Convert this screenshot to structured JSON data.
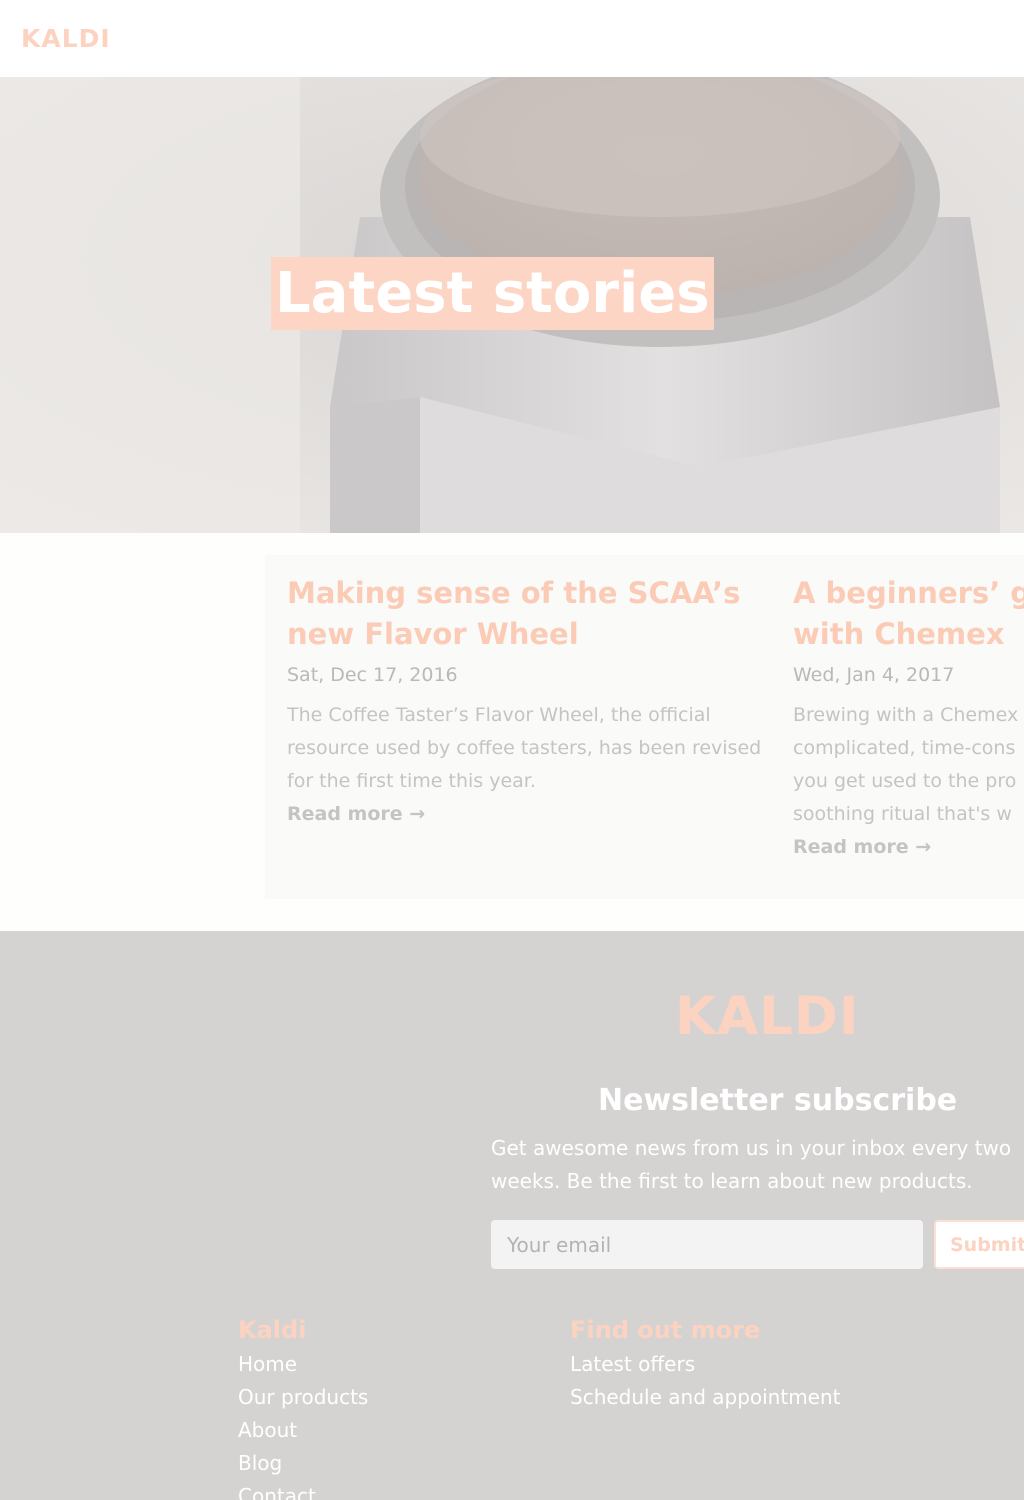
{
  "header": {
    "logo": "KALDI"
  },
  "hero": {
    "title": "Latest stories"
  },
  "stories": [
    {
      "title_line1": "Making sense of the SCAA’s",
      "title_line2": "new Flavor Wheel",
      "date": "Sat, Dec 17, 2016",
      "excerpt_lines": [
        "The Coffee Taster’s Flavor Wheel, the official",
        "resource used by coffee tasters, has been revised",
        "for the first time this year."
      ],
      "read_more": "Read more →"
    },
    {
      "title_line1": "A beginners’ gu",
      "title_line2": "with Chemex",
      "date": "Wed, Jan 4, 2017",
      "excerpt_lines": [
        "Brewing with a Chemex",
        "complicated, time-cons",
        "you get used to the pro",
        "soothing ritual that's w"
      ],
      "read_more": "Read more →"
    }
  ],
  "footer": {
    "logo": "KALDI",
    "newsletter_title": "Newsletter subscribe",
    "newsletter_text_line1": "Get awesome news from us in your inbox every two",
    "newsletter_text_line2": "weeks. Be the first to learn about new products.",
    "email_placeholder": "Your email",
    "submit_label": "Submit",
    "columns": [
      {
        "title": "Kaldi",
        "links": [
          "Home",
          "Our products",
          "About",
          "Blog",
          "Contact"
        ]
      },
      {
        "title": "Find out more",
        "links": [
          "Latest offers",
          "Schedule and appointment"
        ]
      }
    ]
  },
  "colors": {
    "accent": "#fcd3c1",
    "footer_bg": "#d5d2d2",
    "muted_text": "#c4c4c4"
  }
}
